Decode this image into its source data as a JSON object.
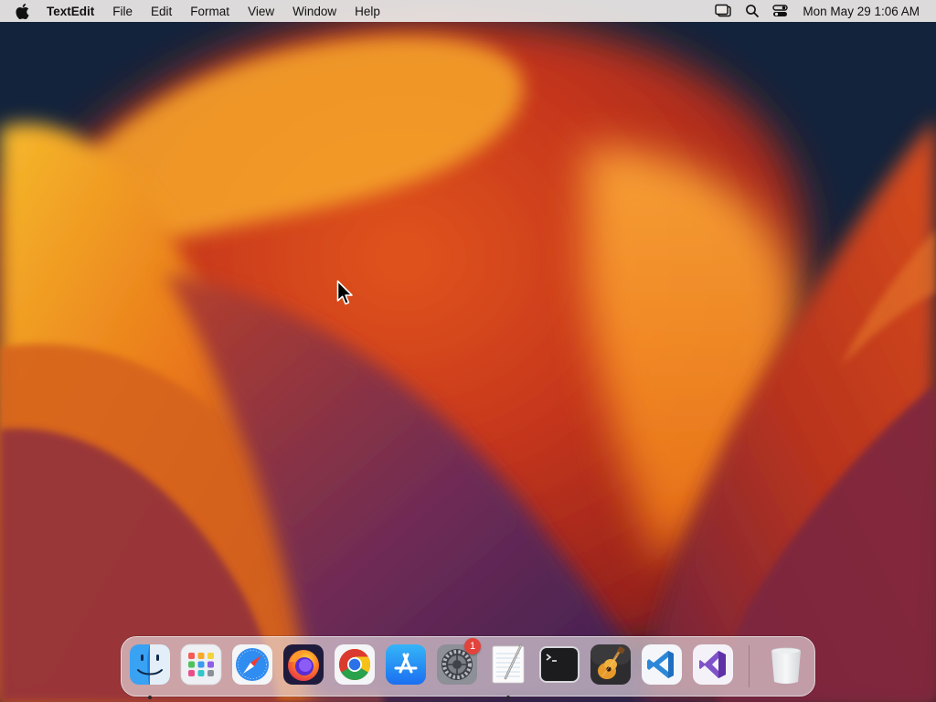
{
  "menubar": {
    "apple_icon": "apple-logo-icon",
    "app_name": "TextEdit",
    "menus": [
      "File",
      "Edit",
      "Format",
      "View",
      "Window",
      "Help"
    ],
    "status_icons": [
      "stage-manager-icon",
      "spotlight-search-icon",
      "control-center-icon"
    ],
    "clock": "Mon May 29  1:06 AM"
  },
  "dock": {
    "apps": [
      {
        "name": "Finder",
        "icon": "finder-icon",
        "running": true
      },
      {
        "name": "Launchpad",
        "icon": "launchpad-icon",
        "running": false
      },
      {
        "name": "Safari",
        "icon": "safari-icon",
        "running": false
      },
      {
        "name": "Firefox",
        "icon": "firefox-icon",
        "running": false
      },
      {
        "name": "Google Chrome",
        "icon": "chrome-icon",
        "running": false
      },
      {
        "name": "App Store",
        "icon": "app-store-icon",
        "running": false
      },
      {
        "name": "System Settings",
        "icon": "system-settings-icon",
        "running": false,
        "badge": "1"
      },
      {
        "name": "TextEdit",
        "icon": "textedit-icon",
        "running": true
      },
      {
        "name": "Terminal",
        "icon": "terminal-icon",
        "running": false
      },
      {
        "name": "GarageBand",
        "icon": "garageband-icon",
        "running": false
      },
      {
        "name": "Visual Studio Code",
        "icon": "vscode-icon",
        "running": false
      },
      {
        "name": "Visual Studio",
        "icon": "visual-studio-icon",
        "running": false
      }
    ],
    "trash": {
      "name": "Trash",
      "icon": "trash-icon"
    }
  },
  "colors": {
    "badge": "#e2433b",
    "wallpaper_orange": "#f08a1c",
    "wallpaper_navy": "#13233b"
  }
}
